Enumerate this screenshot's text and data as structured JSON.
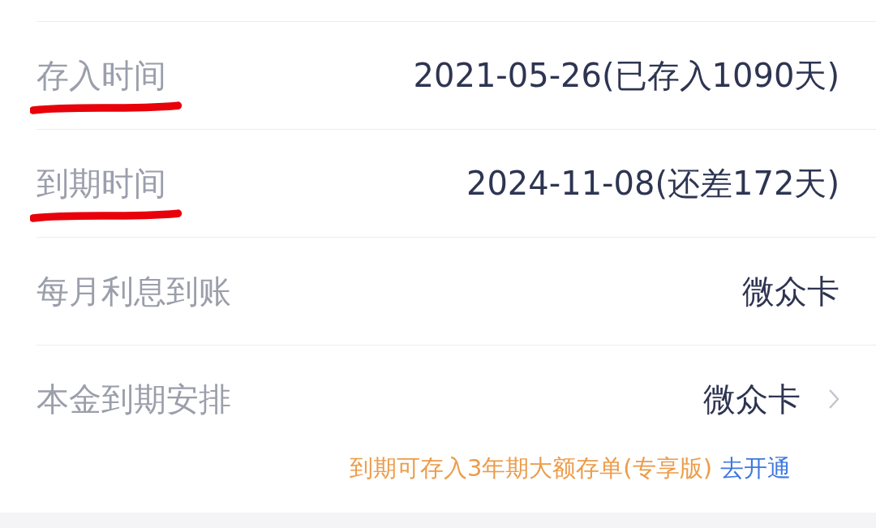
{
  "rows": [
    {
      "label": "存入时间",
      "value": "2021-05-26(已存入1090天)",
      "kind": "plain",
      "underlined": true
    },
    {
      "label": "到期时间",
      "value": "2024-11-08(还差172天)",
      "kind": "plain",
      "underlined": true
    },
    {
      "label": "每月利息到账",
      "value": "微众卡",
      "kind": "plain",
      "underlined": false
    },
    {
      "label": "本金到期安排",
      "value": "微众卡",
      "kind": "link",
      "underlined": false
    }
  ],
  "note": {
    "text": "到期可存入3年期大额存单(专享版)",
    "link": "去开通"
  }
}
